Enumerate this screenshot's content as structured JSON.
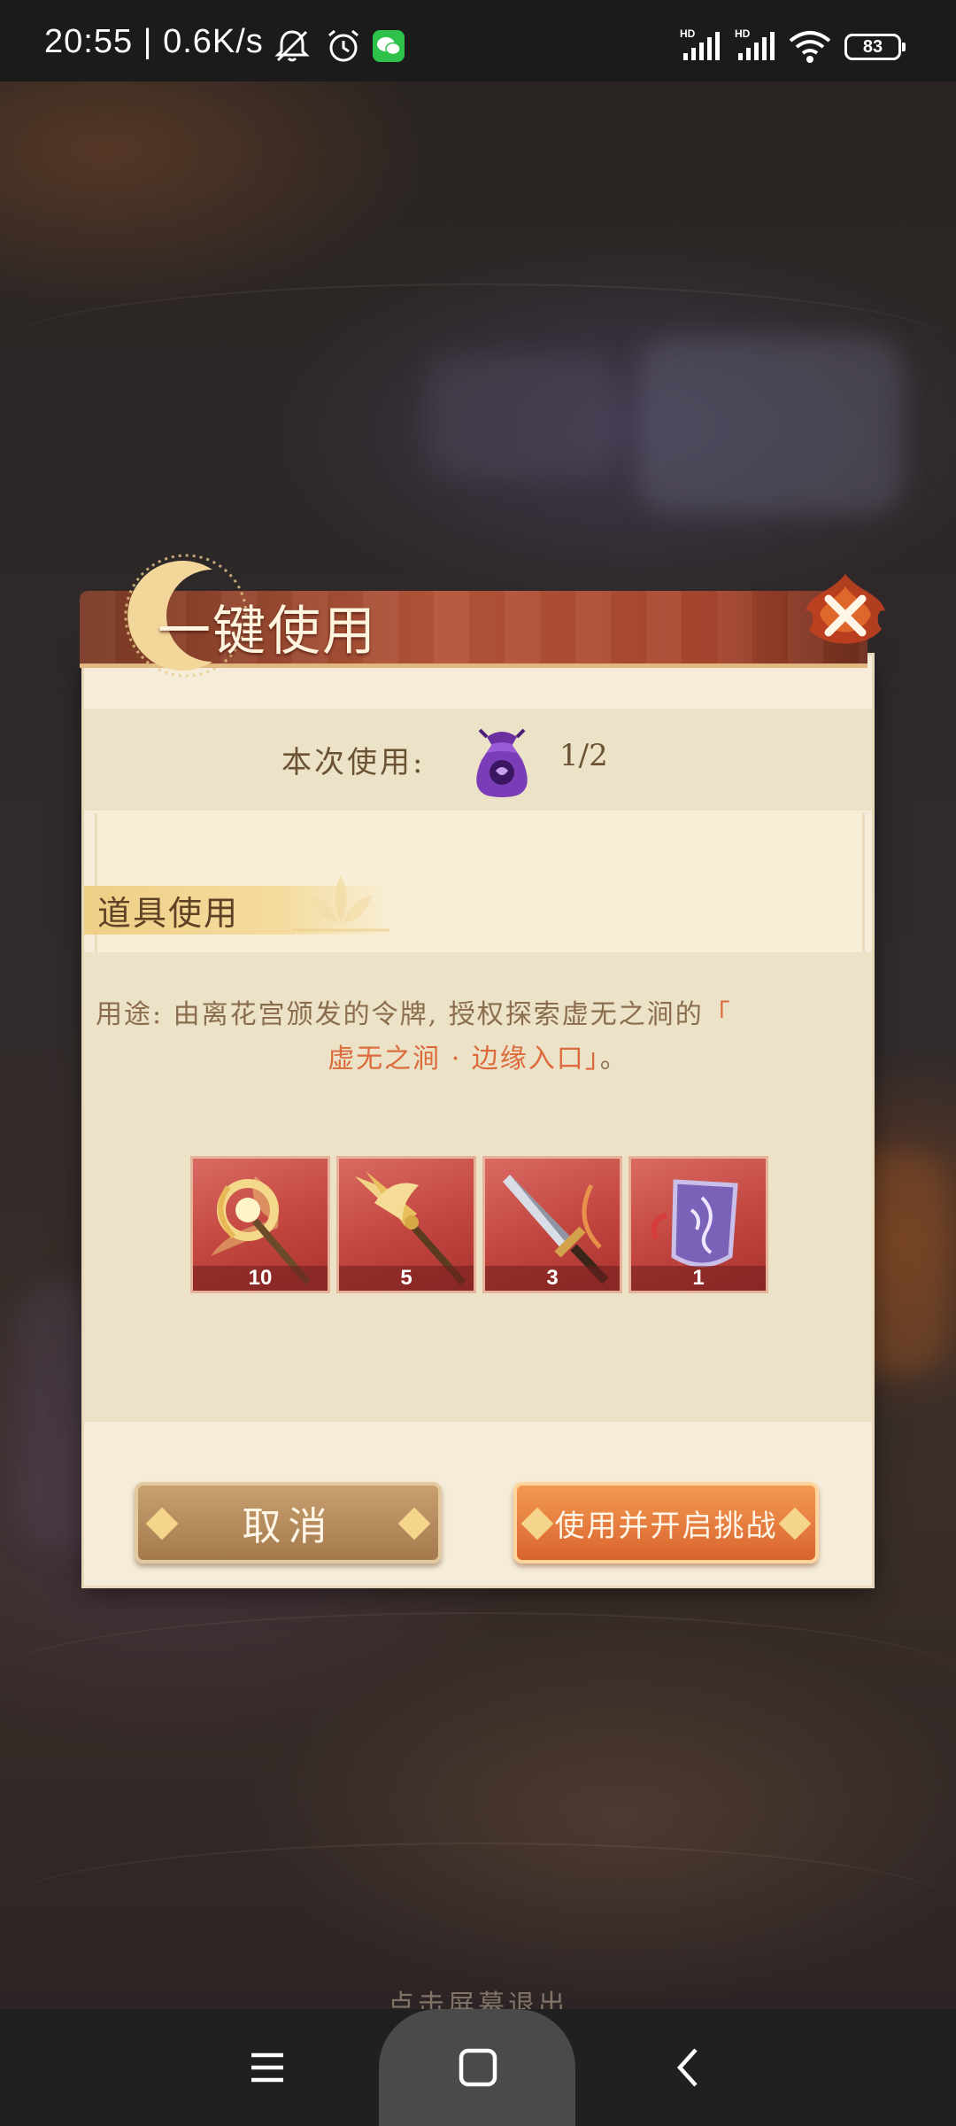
{
  "status_bar": {
    "time": "20:55 | 0.6K/s",
    "battery": "83",
    "icons": [
      "mute-bell-icon",
      "alarm-icon",
      "wechat-icon",
      "signal-hd-icon",
      "signal-hd-icon",
      "wifi-icon",
      "battery-icon"
    ]
  },
  "dialog": {
    "title": "一键使用",
    "usage_label": "本次使用:",
    "usage_item_icon": "purple-pouch-icon",
    "usage_count": "1/2",
    "section_title": "道具使用",
    "description": {
      "prefix": "用途: 由离花宫颁发的令牌, 授权探索虚无之涧的",
      "open_bracket": "「",
      "highlight": "虚无之涧 · 边缘入口",
      "close_bracket": "」",
      "suffix": "。"
    },
    "items": [
      {
        "icon": "golden-crescent-staff-icon",
        "count": "10"
      },
      {
        "icon": "golden-spear-icon",
        "count": "5"
      },
      {
        "icon": "silver-dagger-icon",
        "count": "3"
      },
      {
        "icon": "purple-token-icon",
        "count": "1"
      }
    ],
    "cancel_label": "取消",
    "confirm_label": "使用并开启挑战"
  },
  "exit_hint": "点击屏幕退出",
  "colors": {
    "title_bar": "#b4553a",
    "panel": "#f5edd9",
    "highlight": "#dc6b3c",
    "confirm": "#e87a3c",
    "cancel": "#b88c5c"
  }
}
